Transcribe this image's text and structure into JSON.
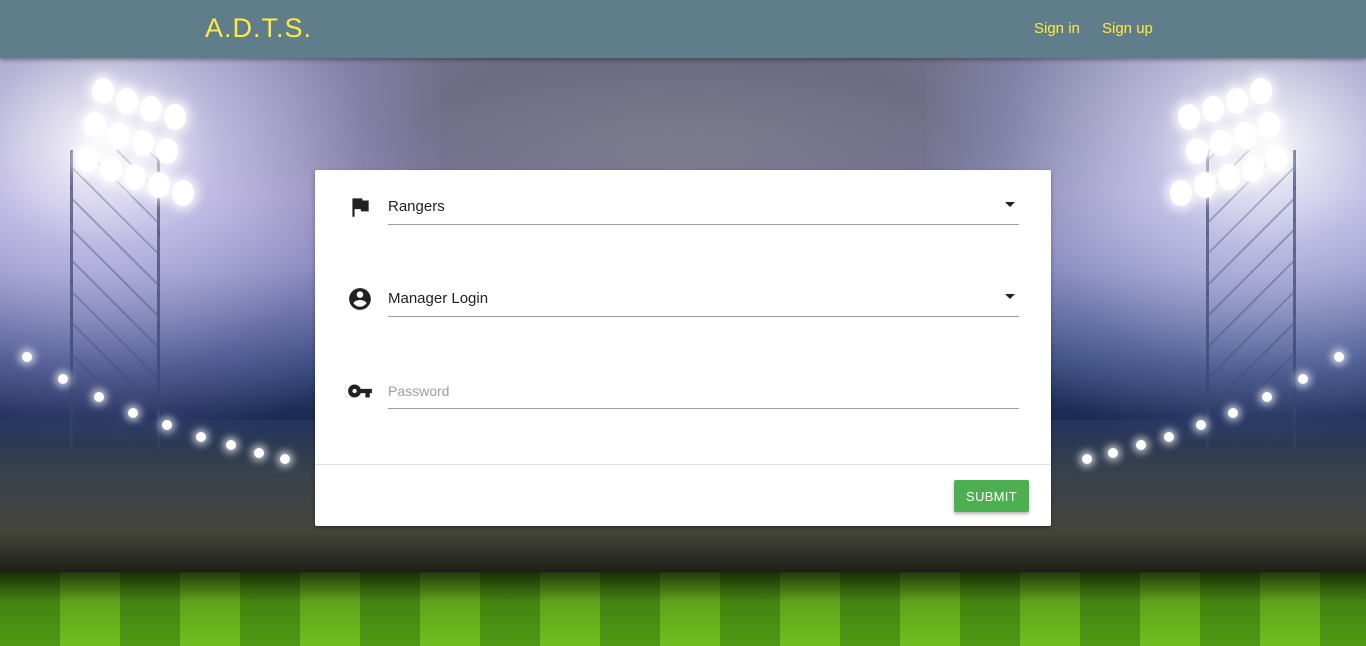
{
  "navbar": {
    "brand": "A.D.T.S.",
    "links": [
      {
        "label": "Sign in"
      },
      {
        "label": "Sign up"
      }
    ],
    "accent_color": "#ffeb3b",
    "background_color": "#607d8b"
  },
  "form": {
    "team_select": {
      "icon": "flag-icon",
      "value": "Rangers"
    },
    "role_select": {
      "icon": "account-circle-icon",
      "value": "Manager Login"
    },
    "password": {
      "icon": "key-icon",
      "placeholder": "Password",
      "value": ""
    },
    "submit_label": "SUBMIT",
    "submit_color": "#4caf50"
  }
}
